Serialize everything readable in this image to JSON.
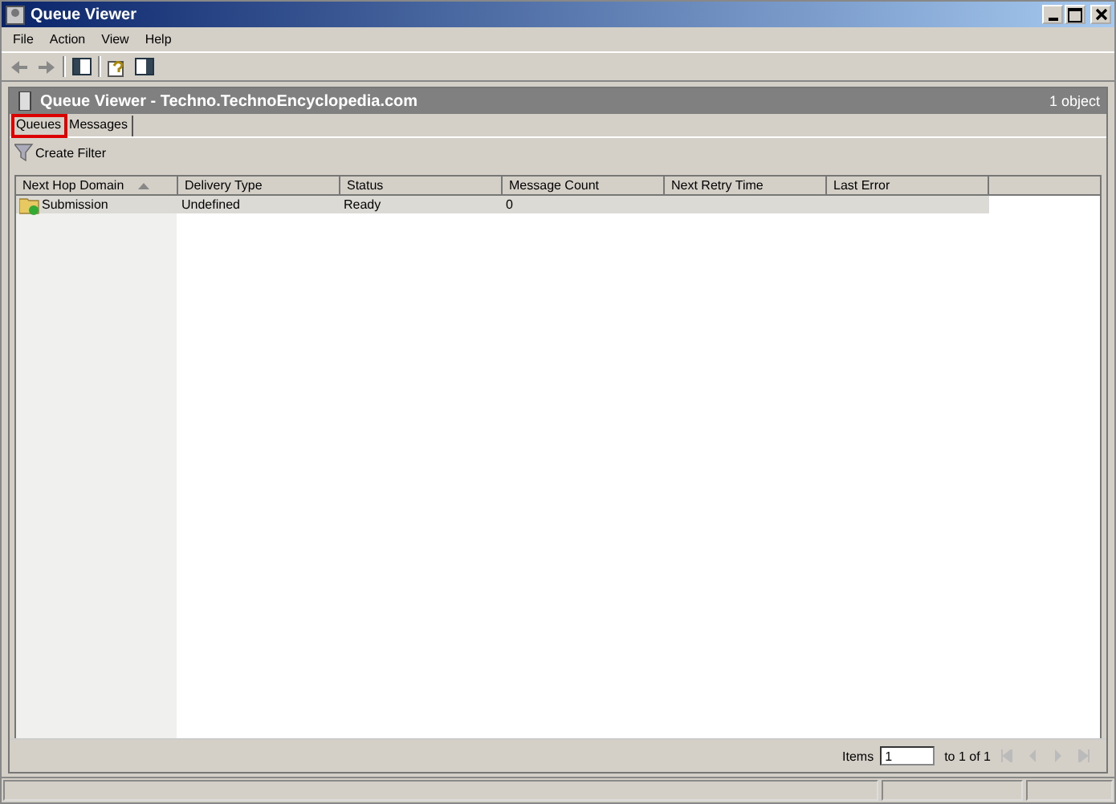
{
  "window": {
    "title": "Queue Viewer"
  },
  "menu": [
    "File",
    "Action",
    "View",
    "Help"
  ],
  "panel": {
    "title": "Queue Viewer - Techno.TechnoEncyclopedia.com",
    "count": "1 object"
  },
  "tabs": [
    {
      "label": "Queues",
      "selected": true
    },
    {
      "label": "Messages",
      "selected": false
    }
  ],
  "filter_button": "Create Filter",
  "table": {
    "columns": [
      {
        "label": "Next Hop Domain",
        "sorted": true
      },
      {
        "label": "Delivery Type",
        "sorted": false
      },
      {
        "label": "Status",
        "sorted": false
      },
      {
        "label": "Message Count",
        "sorted": false
      },
      {
        "label": "Next Retry Time",
        "sorted": false
      },
      {
        "label": "Last Error",
        "sorted": false
      }
    ],
    "rows": [
      {
        "selected": true,
        "cells": [
          "Submission",
          "Undefined",
          "Ready",
          "0",
          "",
          ""
        ]
      }
    ]
  },
  "pager": {
    "label": "Items",
    "value": "1",
    "range": "to 1 of 1"
  }
}
